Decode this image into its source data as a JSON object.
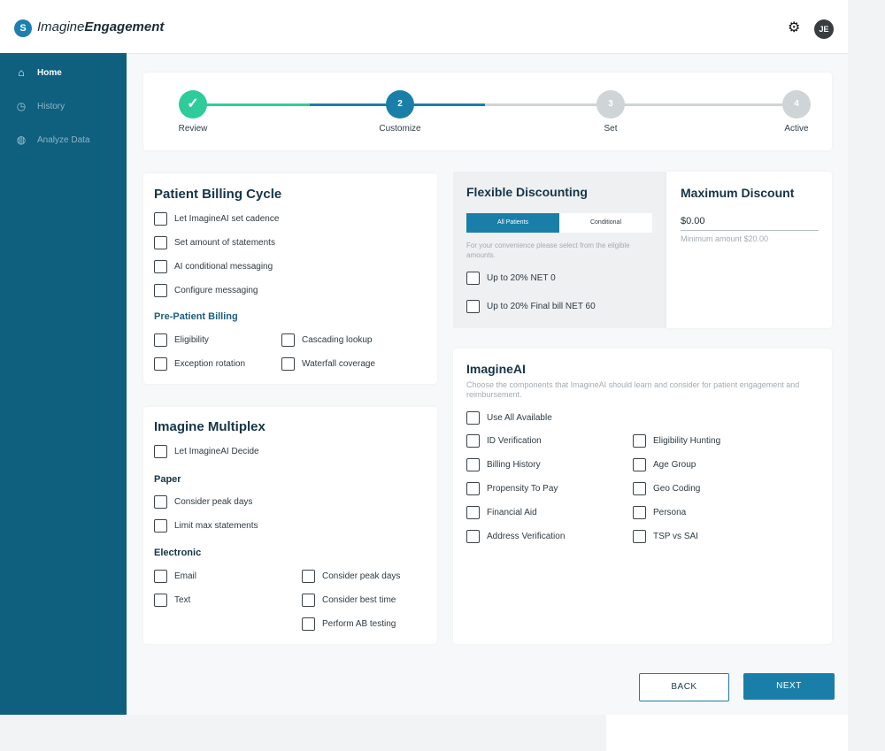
{
  "brand": {
    "mark": "S",
    "name_light": "Imagine",
    "name_bold": "Engagement"
  },
  "header": {
    "settings_icon": "gear-icon",
    "avatar_initials": "JE"
  },
  "sidebar": {
    "items": [
      {
        "label": "Home",
        "icon": "home-icon",
        "active": true
      },
      {
        "label": "History",
        "icon": "clock-icon",
        "active": false
      },
      {
        "label": "Analyze Data",
        "icon": "globe-icon",
        "active": false
      }
    ]
  },
  "stepper": {
    "steps": [
      {
        "label": "Review",
        "badge": "✓",
        "state": "complete"
      },
      {
        "label": "Customize",
        "badge": "2",
        "state": "current"
      },
      {
        "label": "Set",
        "badge": "3",
        "state": "upcoming"
      },
      {
        "label": "Active",
        "badge": "4",
        "state": "upcoming"
      }
    ],
    "colors": {
      "complete": "#2ecc9a",
      "current": "#1a7fa8",
      "upcoming": "#cfd4d7"
    }
  },
  "billing_cycle": {
    "title": "Patient Billing Cycle",
    "options": [
      "Let ImagineAI set cadence",
      "Set amount of statements",
      "AI conditional messaging",
      "Configure messaging"
    ],
    "pre_patient": {
      "title": "Pre-Patient Billing",
      "options": [
        "Eligibility",
        "Cascading lookup",
        "Exception rotation",
        "Waterfall coverage"
      ]
    }
  },
  "multiplex": {
    "title": "Imagine Multiplex",
    "decide": "Let ImagineAI Decide",
    "paper": {
      "title": "Paper",
      "options": [
        "Consider peak days",
        "Limit max statements"
      ]
    },
    "electronic": {
      "title": "Electronic",
      "options": [
        "Email",
        "Text",
        "Consider peak days",
        "Consider best time",
        "Perform AB testing"
      ]
    }
  },
  "flexible_discounting": {
    "title": "Flexible Discounting",
    "tabs": [
      "All Patients",
      "Conditional"
    ],
    "hint": "For your convenience please select from the eligible amounts.",
    "options": [
      "Up to 20% NET 0",
      "Up to 20% Final bill NET 60"
    ]
  },
  "max_discount": {
    "title": "Maximum Discount",
    "value": "$0.00",
    "note": "Minimum amount $20.00"
  },
  "imagine_ai": {
    "title": "ImagineAI",
    "description": "Choose the components that ImagineAI should learn and consider for patient engagement and reimbursement.",
    "use_all": "Use All Available",
    "left_options": [
      "ID Verification",
      "Billing History",
      "Propensity To Pay",
      "Financial Aid",
      "Address Verification"
    ],
    "right_options": [
      "Eligibility Hunting",
      "Age Group",
      "Geo Coding",
      "Persona",
      "TSP vs SAI"
    ]
  },
  "footer": {
    "back_label": "BACK",
    "next_label": "NEXT"
  },
  "colors": {
    "sidebar": "#0f5f7f",
    "accent": "#1a7fa8",
    "success": "#2ecc9a"
  }
}
